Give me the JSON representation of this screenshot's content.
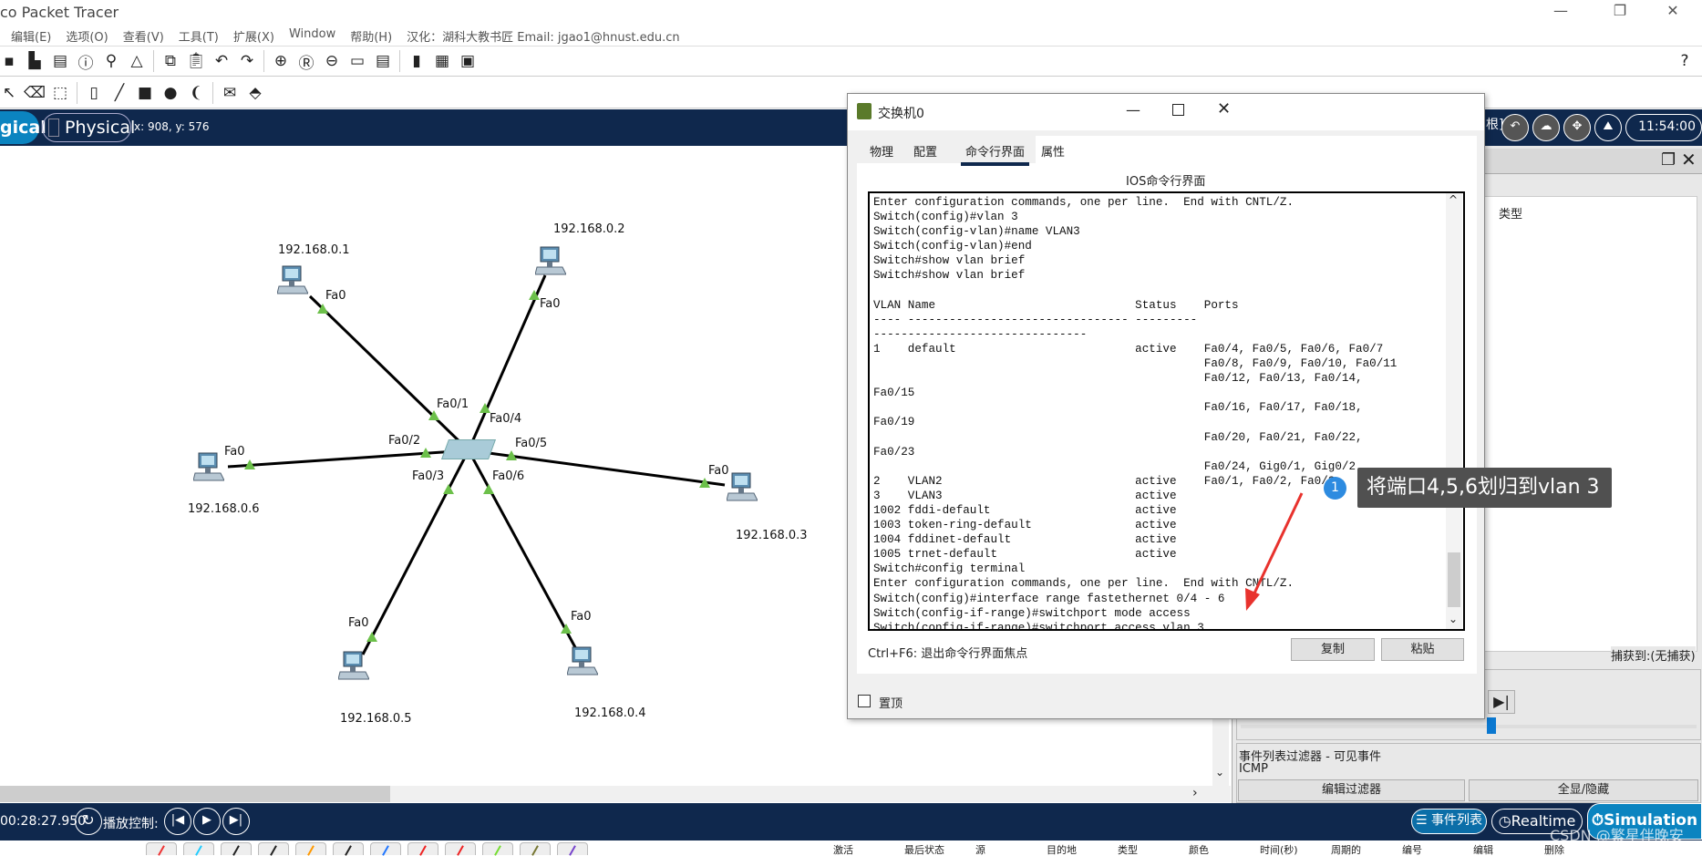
{
  "app": {
    "title": "co Packet Tracer",
    "min": "—",
    "restore": "❐",
    "close": "✕"
  },
  "menu": [
    "编辑(E)",
    "选项(O)",
    "查看(V)",
    "工具(T)",
    "扩展(X)",
    "Window",
    "帮助(H)",
    "汉化：湖科大教书匠  Email: jgao1@hnust.edu.cn"
  ],
  "toolbar1": [
    "new-icon",
    "save-icon",
    "print-icon",
    "info-icon",
    "activity-wizard-icon",
    "pdu-icon",
    "copy-icon",
    "paste-icon",
    "undo-icon",
    "redo-icon",
    "zoom-in-icon",
    "zoom-reset-icon",
    "zoom-out-icon",
    "drawing-palette-icon",
    "custom-device-icon",
    "ipc-icon",
    "server-icon",
    "cloud-image-icon",
    "help-icon"
  ],
  "toolbar2": [
    "select-icon",
    "delete-icon",
    "resize-icon",
    "note-icon",
    "line-icon",
    "rectangle-icon",
    "ellipse-icon",
    "freeform-icon",
    "simple-pdu-icon",
    "complex-pdu-icon"
  ],
  "workspace": {
    "logical": "gical",
    "physical": "Physical",
    "coords": "x: 908, y: 576",
    "root": "根]",
    "clock": "11:54:00"
  },
  "network": {
    "switch_ports": [
      "Fa0/1",
      "Fa0/2",
      "Fa0/3",
      "Fa0/4",
      "Fa0/5",
      "Fa0/6"
    ],
    "pcs": [
      {
        "ip": "192.168.0.1",
        "port": "Fa0"
      },
      {
        "ip": "192.168.0.2",
        "port": "Fa0"
      },
      {
        "ip": "192.168.0.6",
        "port": "Fa0"
      },
      {
        "ip": "192.168.0.3",
        "port": "Fa0"
      },
      {
        "ip": "192.168.0.5",
        "port": "Fa0"
      },
      {
        "ip": "192.168.0.4",
        "port": "Fa0"
      }
    ],
    "link_color": "#000000",
    "port_up_color": "#6cc04a"
  },
  "dialog": {
    "title": "交换机0",
    "tabs": [
      "物理",
      "配置",
      "命令行界面",
      "属性"
    ],
    "active_tab": "命令行界面",
    "heading": "IOS命令行界面",
    "terminal": [
      "Enter configuration commands, one per line.  End with CNTL/Z.",
      "Switch(config)#vlan 3",
      "Switch(config-vlan)#name VLAN3",
      "Switch(config-vlan)#end",
      "Switch#show vlan brief",
      "Switch#show vlan brief",
      "",
      "VLAN Name                             Status    Ports",
      "---- -------------------------------- ---------",
      "-------------------------------",
      "1    default                          active    Fa0/4, Fa0/5, Fa0/6, Fa0/7",
      "                                                Fa0/8, Fa0/9, Fa0/10, Fa0/11",
      "                                                Fa0/12, Fa0/13, Fa0/14,",
      "Fa0/15",
      "                                                Fa0/16, Fa0/17, Fa0/18,",
      "Fa0/19",
      "                                                Fa0/20, Fa0/21, Fa0/22,",
      "Fa0/23",
      "                                                Fa0/24, Gig0/1, Gig0/2",
      "2    VLAN2                            active    Fa0/1, Fa0/2, Fa0/3",
      "3    VLAN3                            active",
      "1002 fddi-default                     active",
      "1003 token-ring-default               active",
      "1004 fddinet-default                  active",
      "1005 trnet-default                    active",
      "Switch#config terminal",
      "Enter configuration commands, one per line.  End with CNTL/Z.",
      "Switch(config)#interface range fastethernet 0/4 - 6",
      "Switch(config-if-range)#switchport mode access",
      "Switch(config-if-range)#switchport access vlan 3"
    ],
    "hint": "Ctrl+F6: 退出命令行界面焦点",
    "copy": "复制",
    "paste": "粘贴",
    "pin": "置顶",
    "pin_checked": false
  },
  "annotation": {
    "number": "1",
    "text": "将端口4,5,6划归到vlan 3",
    "arrow_color": "#e8322d"
  },
  "right_panel": {
    "type_header": "类型",
    "captured": "捕获到:(无捕获)",
    "filter_title": "事件列表过滤器 - 可见事件",
    "filter_value": "ICMP",
    "edit_filter": "编辑过滤器",
    "show_hide": "全显/隐藏",
    "slider_level": 0.55
  },
  "bottom": {
    "time": "00:28:27.950",
    "playback": "播放控制:",
    "event_list": "事件列表",
    "realtime": "Realtime",
    "simulation": "Simulation",
    "watermark": "CSDN @繁星伴晚安",
    "pdu_columns": [
      "激活",
      "最后状态",
      "源",
      "目的地",
      "类型",
      "颜色",
      "时间(秒)",
      "周期的",
      "编号",
      "编辑",
      "删除"
    ]
  }
}
